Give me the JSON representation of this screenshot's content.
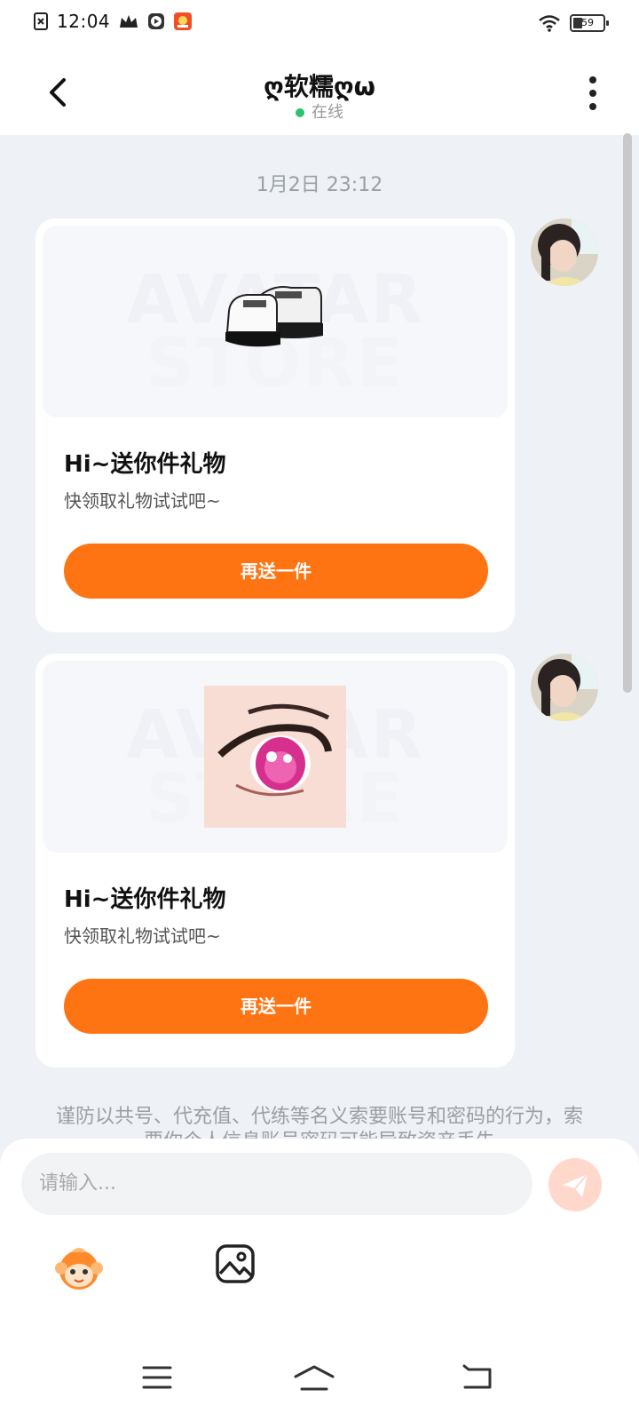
{
  "status_bar": {
    "time": "12:04",
    "battery": "59"
  },
  "header": {
    "title": "ღ软糯ღω",
    "status": "在线",
    "status_color": "#2cc36b"
  },
  "chat": {
    "timestamp": "1月2日 23:12",
    "messages": [
      {
        "image_watermark_top": "AVATAR",
        "image_watermark_bottom": "STORE",
        "item": "shoes-image",
        "title": "Hi~送你件礼物",
        "subtitle": "快领取礼物试试吧~",
        "button": "再送一件"
      },
      {
        "image_watermark_top": "AVATAR",
        "image_watermark_bottom": "STORE",
        "item": "eye-image",
        "title": "Hi~送你件礼物",
        "subtitle": "快领取礼物试试吧~",
        "button": "再送一件"
      }
    ],
    "notice": "谨防以共号、代充值、代练等名义索要账号和密码的行为，索要你个人信息账号密码可能导致资产丢失"
  },
  "composer": {
    "placeholder": "请输入...",
    "icons": [
      "mascot-icon",
      "image-icon",
      "send-icon"
    ]
  },
  "colors": {
    "accent": "#ff7412",
    "background": "#eef1f5"
  }
}
